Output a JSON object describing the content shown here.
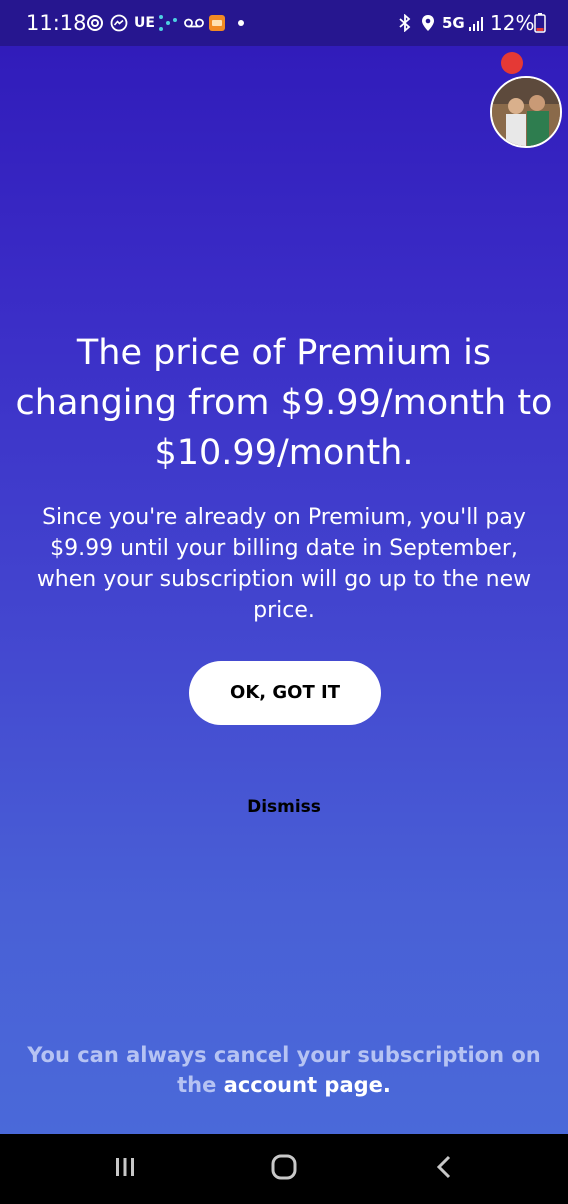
{
  "status_bar": {
    "time": "11:18",
    "carrier_label": "UE",
    "network": "5G",
    "battery": "12%",
    "icons": [
      "sync-icon",
      "messenger-icon",
      "dots-icon",
      "voicemail-icon",
      "app-notification-icon",
      "dot-icon",
      "bluetooth-icon",
      "location-icon",
      "signal-icon",
      "battery-icon"
    ],
    "background": "#26168f"
  },
  "modal": {
    "headline": "The price of Premium is changing from $9.99/month to $10.99/month.",
    "body": "Since you're already on Premium, you'll pay $9.99 until your billing date in September, when your subscription will go up to the new price.",
    "primary_button": "OK, GOT IT",
    "dismiss": "Dismiss",
    "footer_prefix": "You can always cancel your subscription on the",
    "footer_link": "account page.",
    "gradient_top": "#2f19b8",
    "gradient_bottom": "#4a69d9"
  },
  "navigation": {
    "buttons": [
      "recent-apps-icon",
      "home-icon",
      "back-icon"
    ]
  }
}
